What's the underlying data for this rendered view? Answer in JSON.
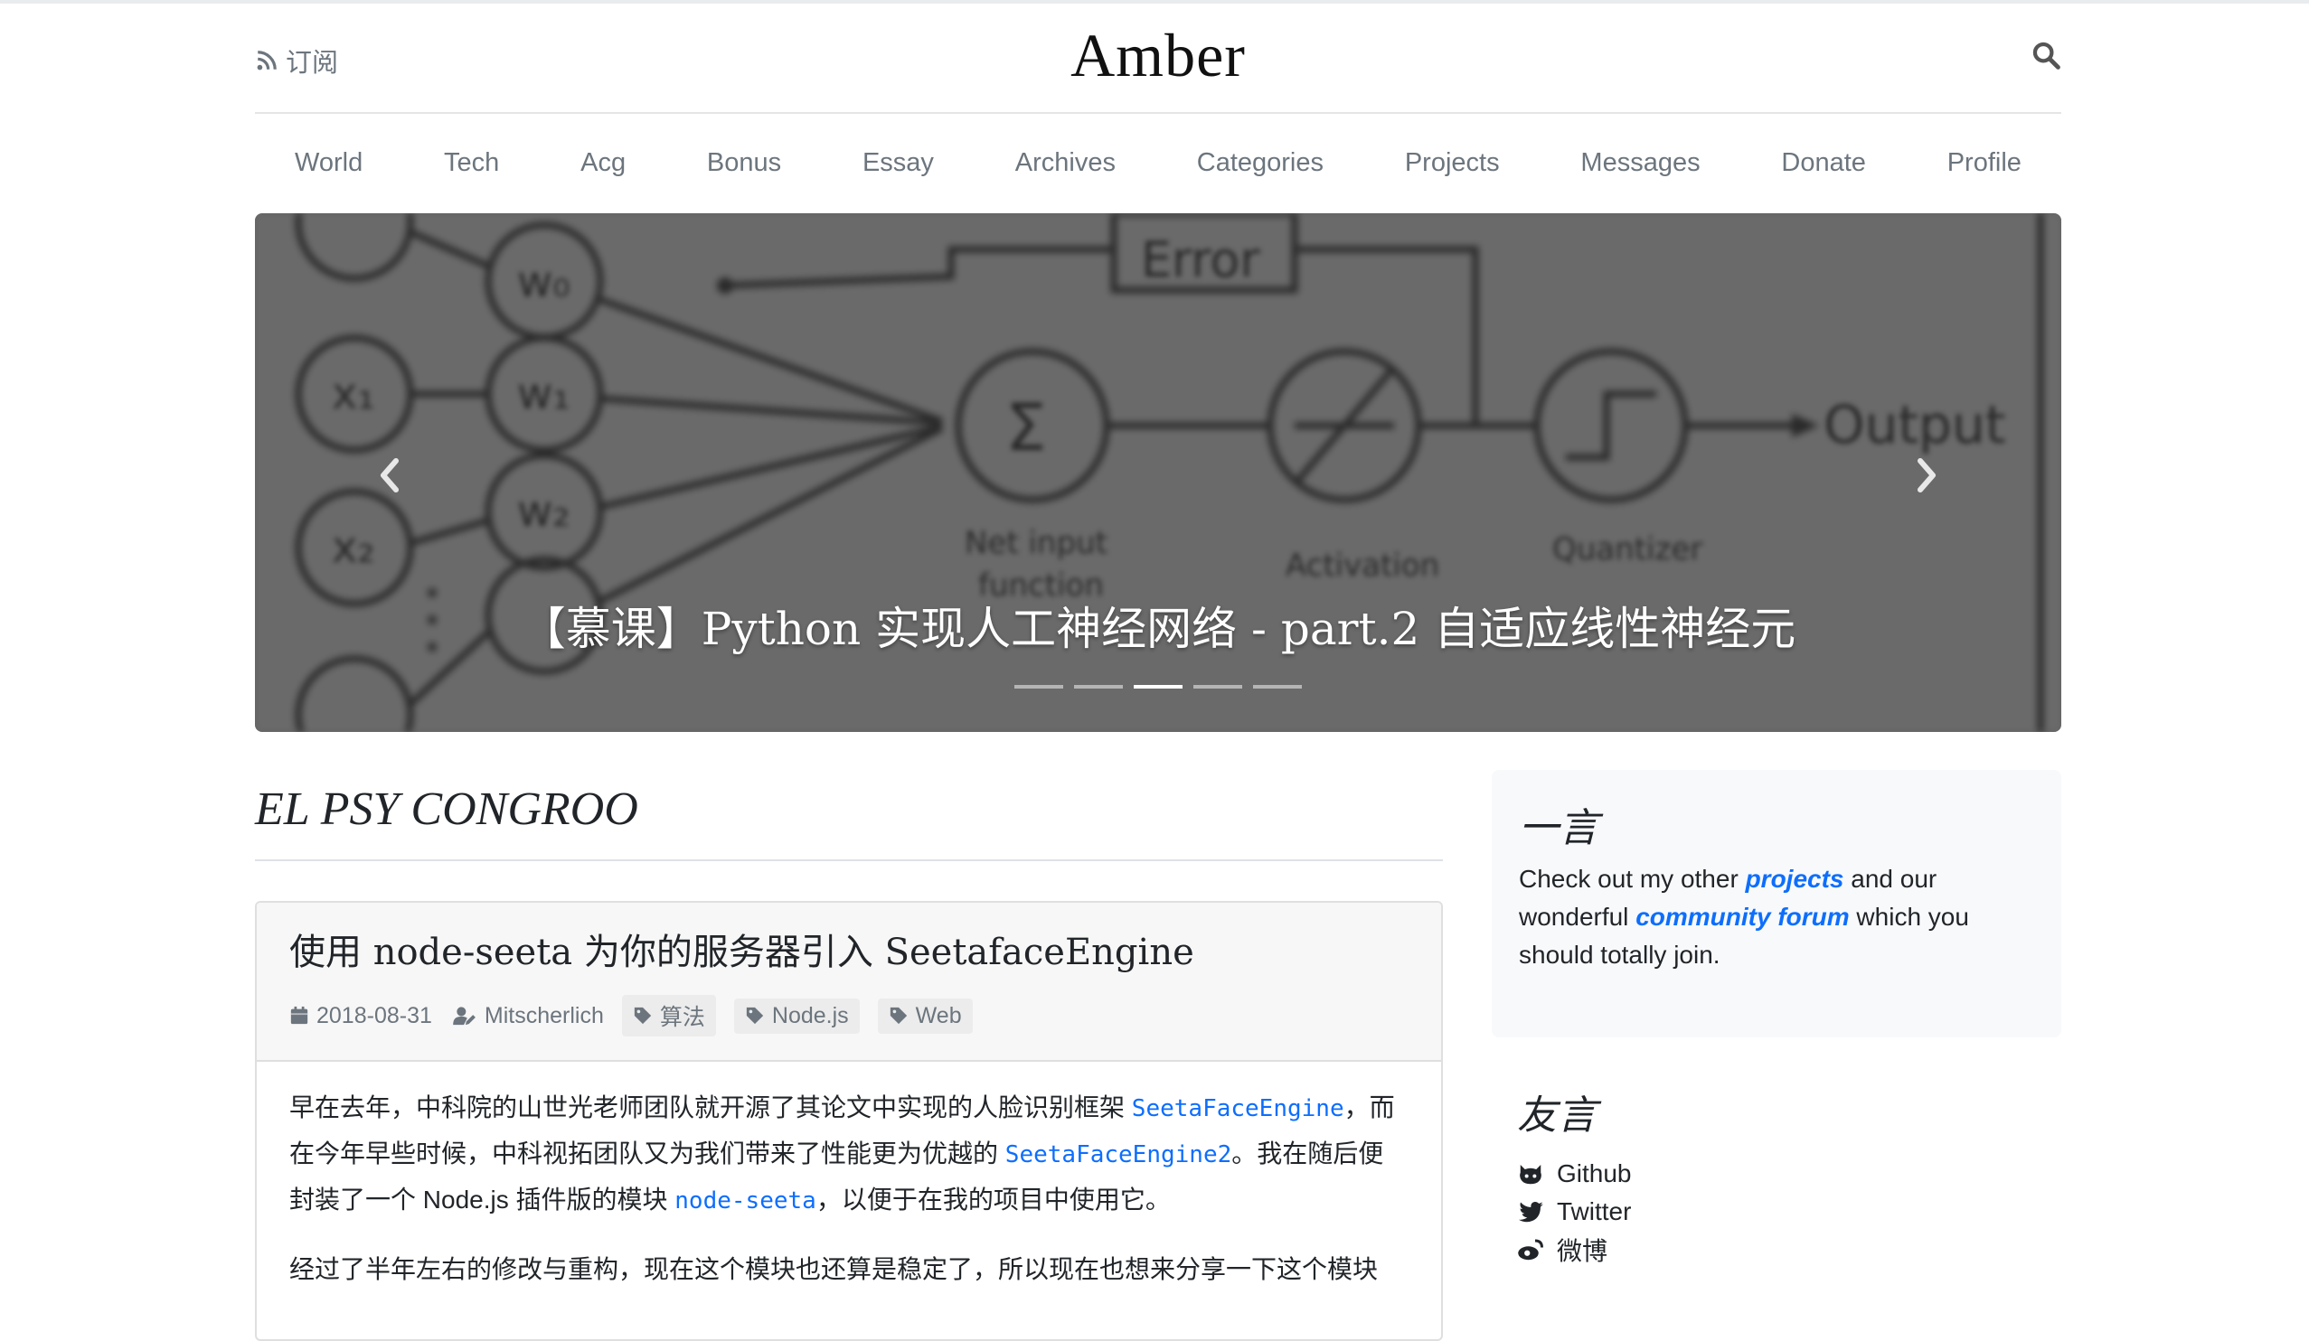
{
  "header": {
    "subscribe_label": "订阅",
    "brand": "Amber"
  },
  "nav": {
    "items": [
      "World",
      "Tech",
      "Acg",
      "Bonus",
      "Essay",
      "Archives",
      "Categories",
      "Projects",
      "Messages",
      "Donate",
      "Profile"
    ]
  },
  "carousel": {
    "caption": "【慕课】Python 实现人工神经网络 - part.2 自适应线性神经元",
    "slide_count": 5,
    "active_index": 2,
    "image_labels": {
      "error": "Error",
      "output": "Output",
      "sum": "Σ",
      "net_input": "Net input",
      "function": "function",
      "activation": "Activation",
      "quantizer": "Quantizer",
      "x1": "x₁",
      "x2": "x₂",
      "w0": "w₀",
      "w1": "w₁",
      "w2": "w₂"
    }
  },
  "main": {
    "heading": "EL PSY CONGROO",
    "post": {
      "title": "使用 node-seeta 为你的服务器引入 SeetafaceEngine",
      "date": "2018-08-31",
      "author": "Mitscherlich",
      "tags": [
        "算法",
        "Node.js",
        "Web"
      ],
      "paragraph1": {
        "part1": "早在去年，中科院的山世光老师团队就开源了其论文中实现的人脸识别框架 ",
        "code1": "SeetaFaceEngine",
        "part2": "，而在今年早些时候，中科视拓团队又为我们带来了性能更为优越的 ",
        "code2": "SeetaFaceEngine2",
        "part3": "。我在随后便封装了一个 Node.js 插件版的模块 ",
        "code3": "node-seeta",
        "part4": "，以便于在我的项目中使用它。"
      },
      "paragraph2": "经过了半年左右的修改与重构，现在这个模块也还算是稳定了，所以现在也想来分享一下这个模块"
    }
  },
  "sidebar": {
    "quote": {
      "title": "一言",
      "text_before": "Check out my other ",
      "link1": "projects",
      "text_middle": " and our wonderful ",
      "link2": "community forum",
      "text_after": " which you should totally join."
    },
    "links": {
      "title": "友言",
      "items": [
        {
          "icon": "github-icon",
          "label": "Github"
        },
        {
          "icon": "twitter-icon",
          "label": "Twitter"
        },
        {
          "icon": "weibo-icon",
          "label": "微博"
        }
      ]
    }
  }
}
